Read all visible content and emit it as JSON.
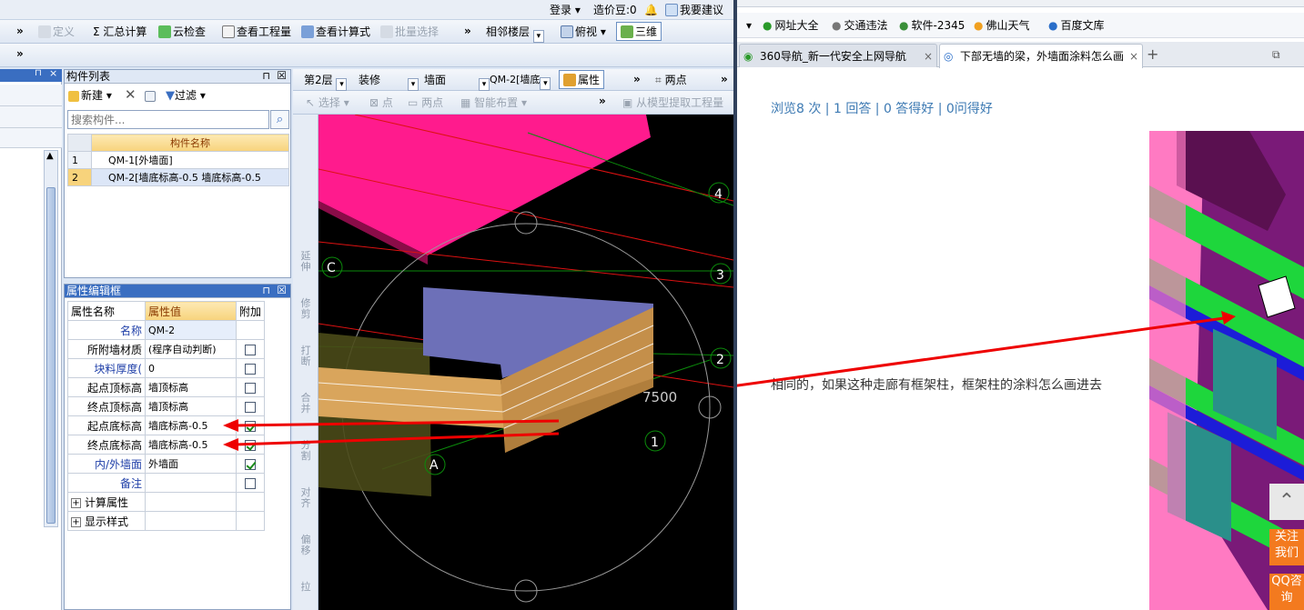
{
  "left_app": {
    "topstrip": {
      "login": "登录 ▾",
      "beans": "造价豆:0",
      "suggest": "我要建议"
    },
    "toolbar1": {
      "define": "定义",
      "summary": "Σ 汇总计算",
      "cloud_check": "云检查",
      "view_quantity": "查看工程量",
      "view_formula": "查看计算式",
      "batch_select": "批量选择",
      "adjacent_floor": "相邻楼层",
      "view_mode": "俯视",
      "three_d": "三维"
    },
    "toolbar2": {
      "floor": "第2层",
      "category": "装修",
      "type": "墙面",
      "component": "QM-2[墙底",
      "attr": "属性",
      "two_point": "两点"
    },
    "toolbar3": {
      "select": "选择 ▾",
      "point": "点",
      "two_point": "两点",
      "smart_layout": "智能布置 ▾",
      "extract": "从模型提取工程量"
    },
    "component_list": {
      "title": "构件列表",
      "new": "新建 ▾",
      "filter": "过滤 ▾",
      "search_placeholder": "搜索构件...",
      "header": "构件名称",
      "rows": [
        {
          "idx": "1",
          "name": "QM-1[外墙面]"
        },
        {
          "idx": "2",
          "name": "QM-2[墙底标高-0.5 墙底标高-0.5"
        }
      ]
    },
    "property_editor": {
      "title": "属性编辑框",
      "headers": [
        "属性名称",
        "属性值",
        "附加"
      ],
      "rows": [
        {
          "name": "名称",
          "value": "QM-2",
          "blue": true,
          "has_check": false,
          "checked": false
        },
        {
          "name": "所附墙材质",
          "value": "(程序自动判断)",
          "blue": false,
          "has_check": true,
          "checked": false
        },
        {
          "name": "块料厚度(",
          "value": "0",
          "blue": true,
          "has_check": true,
          "checked": false
        },
        {
          "name": "起点顶标高",
          "value": "墙顶标高",
          "blue": false,
          "has_check": true,
          "checked": false
        },
        {
          "name": "终点顶标高",
          "value": "墙顶标高",
          "blue": false,
          "has_check": true,
          "checked": false
        },
        {
          "name": "起点底标高",
          "value": "墙底标高-0.5",
          "blue": false,
          "has_check": true,
          "checked": true
        },
        {
          "name": "终点底标高",
          "value": "墙底标高-0.5",
          "blue": false,
          "has_check": true,
          "checked": true
        },
        {
          "name": "内/外墙面",
          "value": "外墙面",
          "blue": true,
          "has_check": true,
          "checked": true
        },
        {
          "name": "备注",
          "value": "",
          "blue": true,
          "has_check": true,
          "checked": false
        }
      ],
      "groups": [
        "计算属性",
        "显示样式"
      ]
    },
    "vertical_tools": [
      "延伸",
      "修剪",
      "打断",
      "合并",
      "分割",
      "对齐",
      "偏移",
      "拉"
    ],
    "viewport": {
      "axis_labels": [
        "4",
        "3",
        "2",
        "1",
        "C",
        "A"
      ],
      "dimension": "7500"
    }
  },
  "browser": {
    "favorites": [
      "网址大全",
      "交通违法",
      "软件-2345",
      "佛山天气",
      "百度文库"
    ],
    "tabs": [
      {
        "label": "360导航_新一代安全上网导航",
        "active": false
      },
      {
        "label": "下部无墙的梁，外墙面涂料怎么画",
        "active": true
      }
    ],
    "stats": "浏览8 次 | 1 回答 | 0 答得好 | 0问得好",
    "question": "相同的，如果这种走廊有框架柱，框架柱的涂料怎么画进去",
    "side_buttons": {
      "follow": "关注我们",
      "qq": "QQ咨询"
    }
  }
}
